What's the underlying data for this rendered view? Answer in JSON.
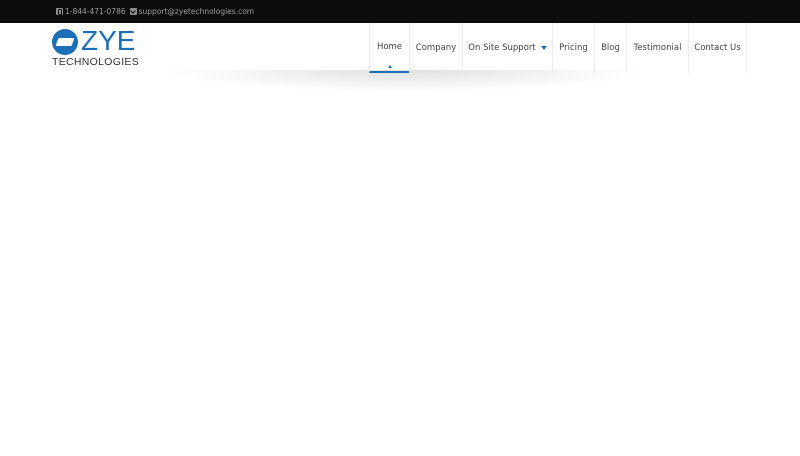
{
  "topbar": {
    "phone": "1-844-471-0786",
    "email": "support@zyetechnologies.com",
    "phone_icon": "phone-icon",
    "email_icon": "envelope-icon"
  },
  "logo": {
    "wordmark": "ZYE",
    "tagline": "TECHNOLOGIES"
  },
  "nav": {
    "items": [
      {
        "label": "Home"
      },
      {
        "label": "Company"
      },
      {
        "label": "On Site Support"
      },
      {
        "label": "Pricing"
      },
      {
        "label": "Blog"
      },
      {
        "label": "Testimonial"
      },
      {
        "label": "Contact Us"
      }
    ],
    "active": "Home"
  },
  "colors": {
    "accent": "#1a6fb8",
    "topbar_bg": "#0d0d0d"
  }
}
